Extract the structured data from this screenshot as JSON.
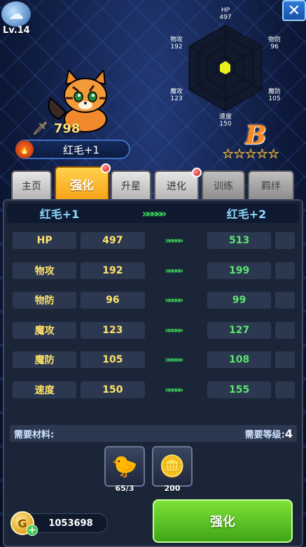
{
  "hero": {
    "level": "Lv.14",
    "power": "798",
    "name": "红毛+1",
    "grade": "B",
    "stars": 5
  },
  "radar": {
    "hp": {
      "label": "HP",
      "value": "497"
    },
    "atk": {
      "label": "物攻",
      "value": "192"
    },
    "def": {
      "label": "物防",
      "value": "96"
    },
    "matk": {
      "label": "魔攻",
      "value": "123"
    },
    "mdef": {
      "label": "魔防",
      "value": "105"
    },
    "spd": {
      "label": "速度",
      "value": "150"
    }
  },
  "tabs": [
    {
      "label": "主页"
    },
    {
      "label": "强化"
    },
    {
      "label": "升星"
    },
    {
      "label": "进化"
    },
    {
      "label": "训练"
    },
    {
      "label": "羁绊"
    }
  ],
  "upgrade": {
    "from": "红毛+1",
    "to": "红毛+2",
    "arrows": "»»»»»"
  },
  "stats": [
    {
      "name": "HP",
      "cur": "497",
      "next": "513"
    },
    {
      "name": "物攻",
      "cur": "192",
      "next": "199"
    },
    {
      "name": "物防",
      "cur": "96",
      "next": "99"
    },
    {
      "name": "魔攻",
      "cur": "123",
      "next": "127"
    },
    {
      "name": "魔防",
      "cur": "105",
      "next": "108"
    },
    {
      "name": "速度",
      "cur": "150",
      "next": "155"
    }
  ],
  "materials": {
    "label": "需要材料:",
    "level_label": "需要等级:",
    "level_value": "4",
    "items": [
      {
        "icon": "chick-icon",
        "count": "65/3"
      },
      {
        "icon": "coin-icon",
        "count": "200"
      }
    ]
  },
  "coins": "1053698",
  "action": "强化",
  "colors": {
    "accent_orange": "#f7a31a",
    "upgrade_green": "#3ed85a",
    "stat_yellow": "#ffe36b"
  }
}
